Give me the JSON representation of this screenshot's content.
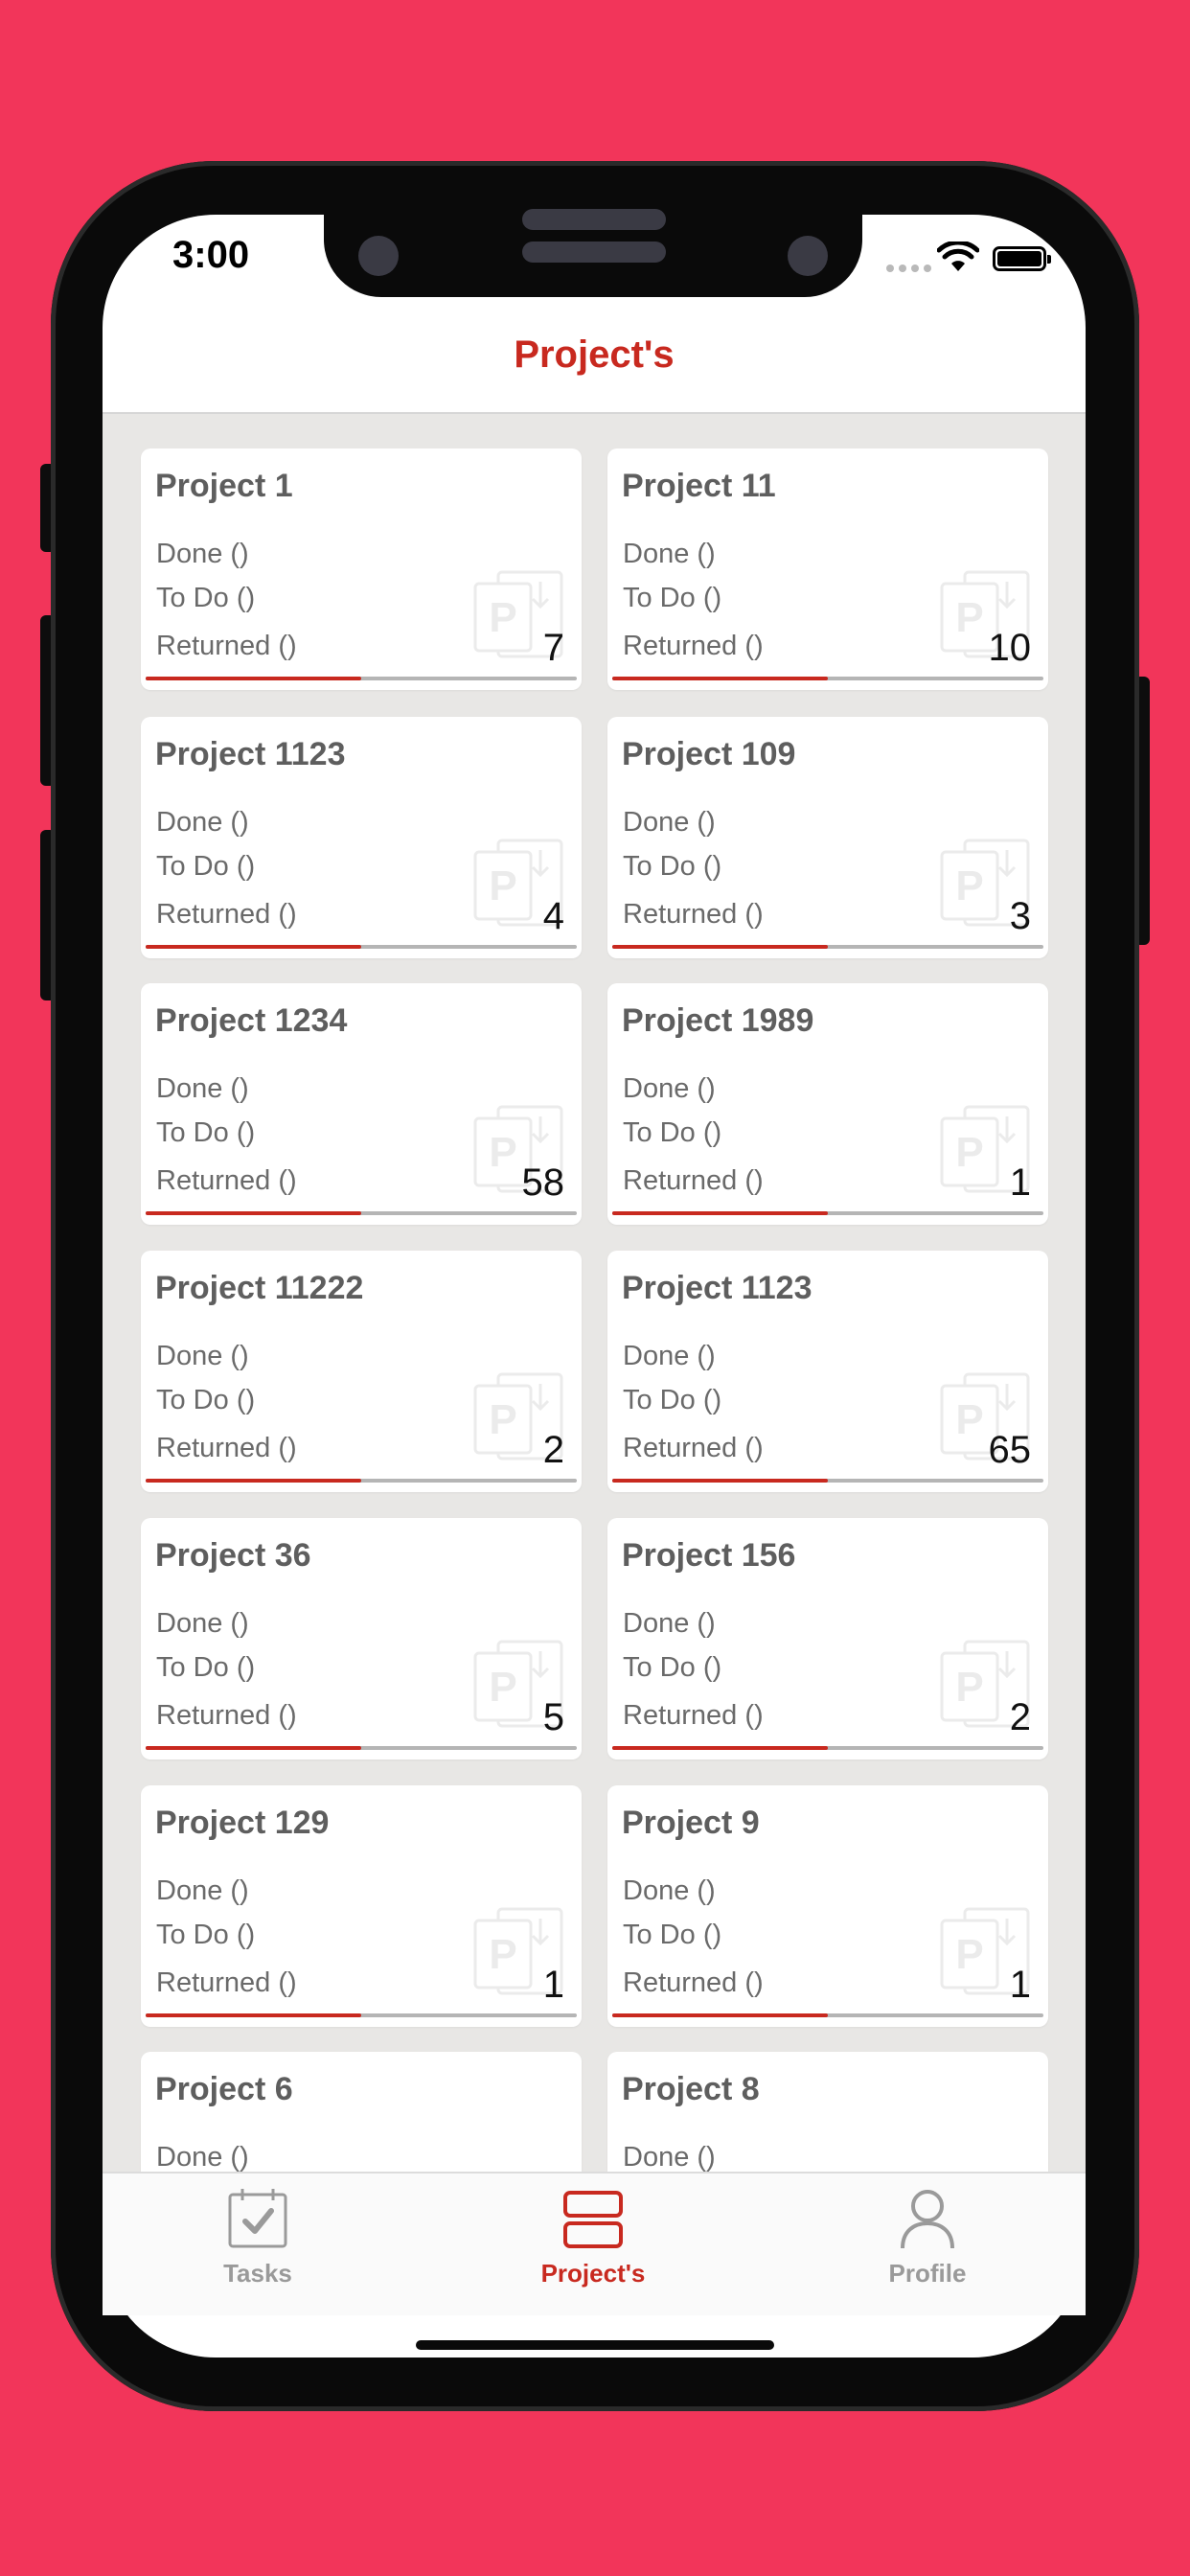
{
  "status": {
    "time": "3:00"
  },
  "nav": {
    "title": "Project's"
  },
  "labels": {
    "done": "Done ()",
    "todo": "To Do ()",
    "returned": "Returned ()"
  },
  "colors": {
    "accent": "#C8291F",
    "background": "#F2355A",
    "content_bg": "#E8E7E5",
    "inactive": "#9a9a9a"
  },
  "projects": [
    {
      "name": "Project 1",
      "count": "7",
      "progress": 0.5
    },
    {
      "name": "Project 11",
      "count": "10",
      "progress": 0.5
    },
    {
      "name": "Project 1123",
      "count": "4",
      "progress": 0.5
    },
    {
      "name": "Project 109",
      "count": "3",
      "progress": 0.5
    },
    {
      "name": "Project 1234",
      "count": "58",
      "progress": 0.5
    },
    {
      "name": "Project 1989",
      "count": "1",
      "progress": 0.5
    },
    {
      "name": "Project 11222",
      "count": "2",
      "progress": 0.5
    },
    {
      "name": "Project 1123",
      "count": "65",
      "progress": 0.5
    },
    {
      "name": "Project 36",
      "count": "5",
      "progress": 0.5
    },
    {
      "name": "Project 156",
      "count": "2",
      "progress": 0.5
    },
    {
      "name": "Project 129",
      "count": "1",
      "progress": 0.5
    },
    {
      "name": "Project 9",
      "count": "1",
      "progress": 0.5
    },
    {
      "name": "Project 6",
      "count": "",
      "progress": 0.5
    },
    {
      "name": "Project 8",
      "count": "",
      "progress": 0.5
    }
  ],
  "tabs": [
    {
      "label": "Tasks",
      "icon": "calendar-check-icon",
      "active": false
    },
    {
      "label": "Project's",
      "icon": "stacked-rectangles-icon",
      "active": true
    },
    {
      "label": "Profile",
      "icon": "person-icon",
      "active": false
    }
  ]
}
